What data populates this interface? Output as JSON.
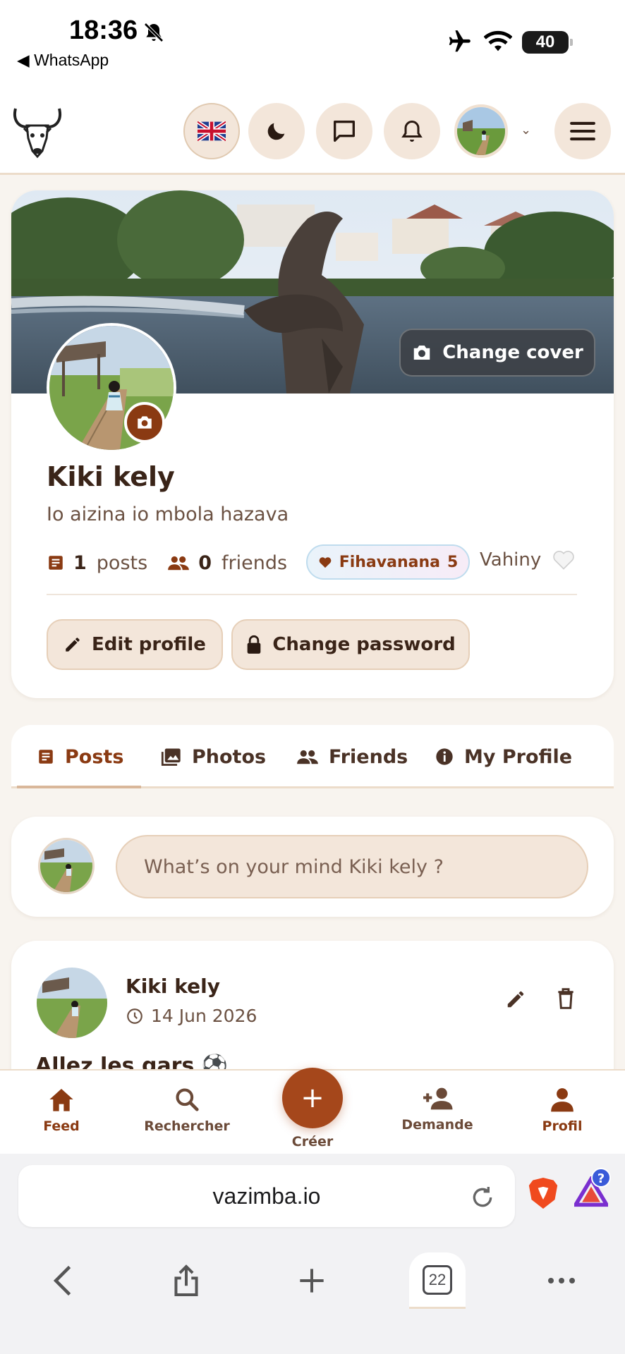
{
  "status_bar": {
    "time": "18:36",
    "back_app": "WhatsApp",
    "battery": "40"
  },
  "header": {
    "icons": [
      "bull-logo-icon",
      "uk-flag-icon",
      "moon-icon",
      "chat-icon",
      "bell-icon",
      "chevron-down-icon",
      "menu-icon"
    ]
  },
  "profile": {
    "change_cover_label": "Change cover",
    "name": "Kiki kely",
    "bio": "Io aizina io mbola hazava",
    "posts_count": "1",
    "posts_label": "posts",
    "friends_count": "0",
    "friends_label": "friends",
    "fihavanana_label": "Fihavanana",
    "fihavanana_count": "5",
    "vahiny_label": "Vahiny",
    "edit_profile_label": "Edit profile",
    "change_password_label": "Change password"
  },
  "tabs": [
    {
      "label": "Posts"
    },
    {
      "label": "Photos"
    },
    {
      "label": "Friends"
    },
    {
      "label": "My Profile"
    }
  ],
  "composer": {
    "placeholder": "What’s on your mind Kiki kely ?"
  },
  "post": {
    "author": "Kiki kely",
    "date": "14 Jun 2026",
    "text": "Allez les gars ⚽"
  },
  "bottom_nav": [
    {
      "label": "Feed"
    },
    {
      "label": "Rechercher"
    },
    {
      "label": "Créer"
    },
    {
      "label": "Demande"
    },
    {
      "label": "Profil"
    }
  ],
  "browser": {
    "url": "vazimba.io",
    "tabs_count": "22",
    "rewards_badge": "?"
  },
  "colors": {
    "accent": "#8a3a12",
    "fab": "#a5471b",
    "chip_bg": "#f3e6da",
    "page_bg": "#f8f4ef"
  }
}
